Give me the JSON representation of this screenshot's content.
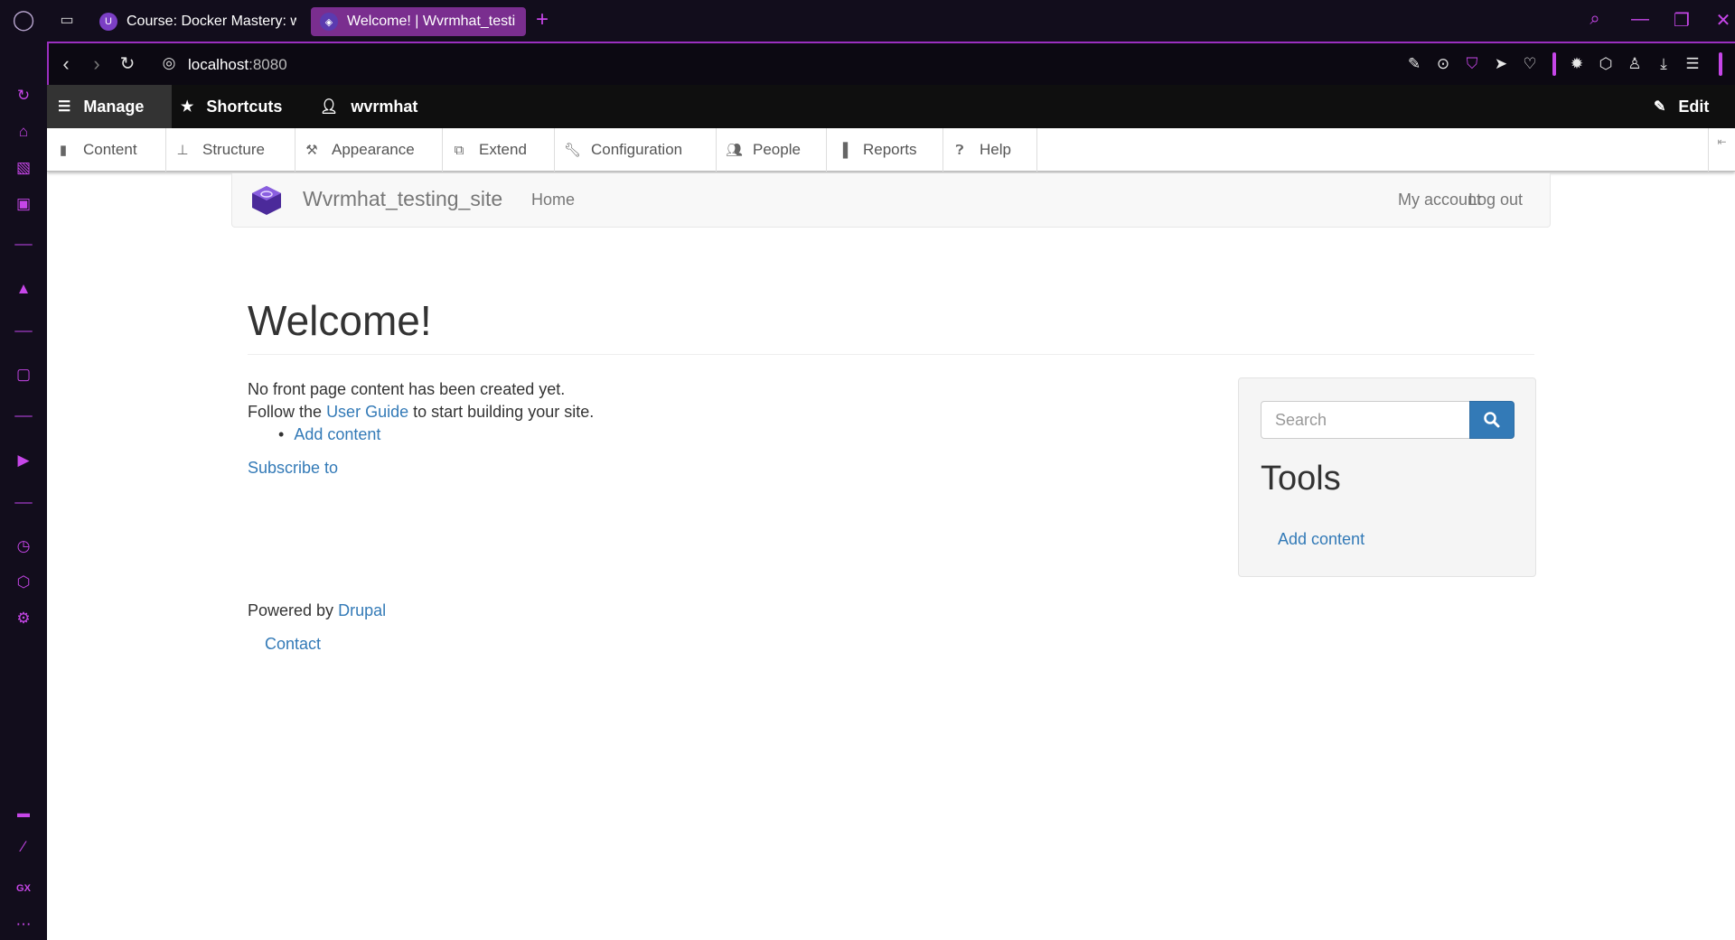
{
  "browser": {
    "tabs": [
      {
        "label": "Course: Docker Mastery: w"
      },
      {
        "label": "Welcome! | Wvrmhat_testi"
      }
    ],
    "address": {
      "host": "localhost",
      "port": ":8080"
    },
    "accent_color": "#c646e8"
  },
  "admin_toolbar": {
    "manage": "Manage",
    "shortcuts": "Shortcuts",
    "user": "wvrmhat",
    "edit": "Edit"
  },
  "tray": {
    "items": [
      "Content",
      "Structure",
      "Appearance",
      "Extend",
      "Configuration",
      "People",
      "Reports",
      "Help"
    ]
  },
  "site": {
    "name": "Wvrmhat_testing_site",
    "nav_home": "Home",
    "my_account": "My account",
    "log_out": "Log out"
  },
  "main": {
    "title": "Welcome!",
    "line1": "No front page content has been created yet.",
    "line2_pre": "Follow the",
    "line2_link": "User Guide",
    "line2_post": "to start building your site.",
    "list_item": "Add content",
    "subscribe": "Subscribe to"
  },
  "sidebar_block": {
    "search_placeholder": "Search",
    "heading": "Tools",
    "link": "Add content"
  },
  "footer": {
    "powered_pre": "Powered by",
    "powered_link": "Drupal",
    "contact": "Contact"
  }
}
